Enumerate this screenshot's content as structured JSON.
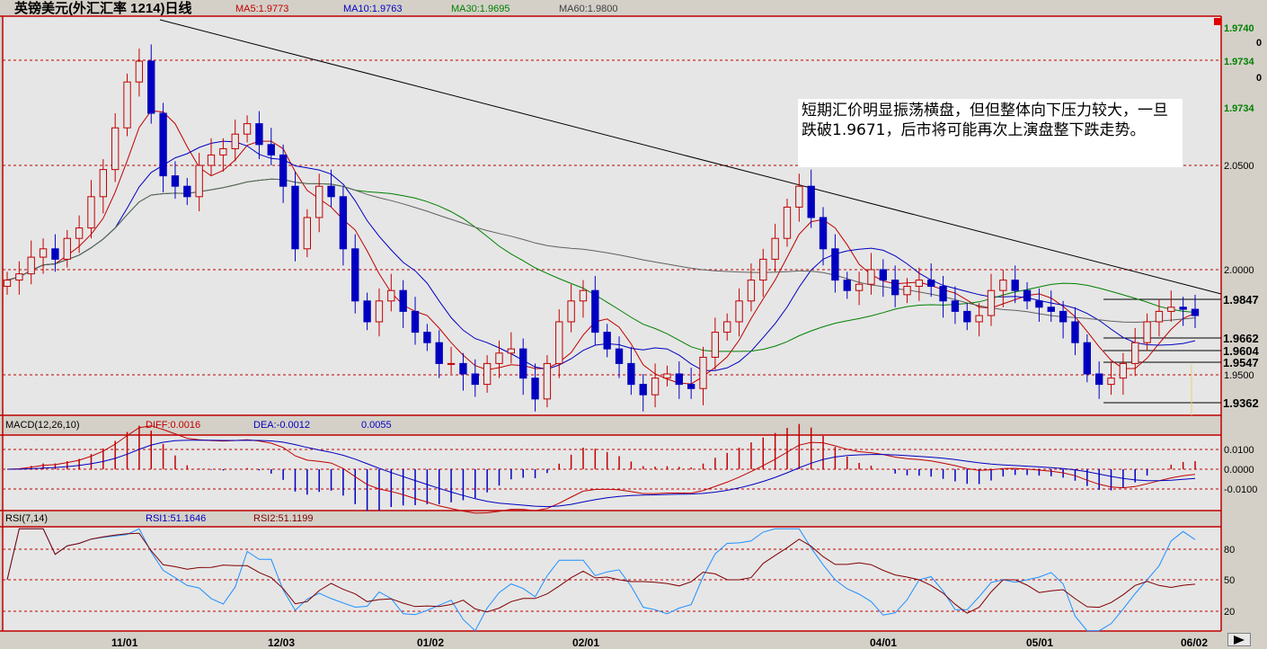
{
  "header": {
    "title": "英镑美元(外汇汇率 1214)日线",
    "ma": [
      {
        "label": "MA5:1.9773",
        "color": "#c00000"
      },
      {
        "label": "MA10:1.9763",
        "color": "#0000c0"
      },
      {
        "label": "MA30:1.9695",
        "color": "#008000"
      },
      {
        "label": "MA60:1.9800",
        "color": "#606060"
      }
    ]
  },
  "annotation": {
    "text": "短期汇价明显振荡横盘，但但整体向下压力较大，一旦跌破1.9671，后市将可能再次上演盘整下跌走势。"
  },
  "right_top_values": [
    "1.9740",
    "0",
    "1.9734",
    "0",
    "1.9734"
  ],
  "price_levels": [
    "1.9847",
    "1.9662",
    "1.9604",
    "1.9547",
    "1.9362"
  ],
  "macd": {
    "title": "MACD(12,26,10)",
    "diff": "DIFF:0.0016",
    "dea": "DEA:-0.0012",
    "macd_value": "0.0055"
  },
  "rsi": {
    "title": "RSI(7,14)",
    "rsi1": "RSI1:51.1646",
    "rsi2": "RSI2:51.1199"
  },
  "x_axis": [
    "11/01",
    "12/03",
    "01/02",
    "02/01",
    "04/01",
    "05/01",
    "06/02"
  ],
  "chart_data": {
    "type": "candlestick",
    "y_axis_ticks": [
      "2.0500",
      "2.0000",
      "1.9500"
    ],
    "macd_ticks": [
      "0.0100",
      "0.0000",
      "-0.0100"
    ],
    "rsi_ticks": [
      "80",
      "50",
      "20"
    ],
    "close_series": [
      1.995,
      1.998,
      2.006,
      2.01,
      2.005,
      2.015,
      2.02,
      2.035,
      2.048,
      2.068,
      2.09,
      2.1,
      2.075,
      2.045,
      2.04,
      2.035,
      2.05,
      2.055,
      2.058,
      2.065,
      2.07,
      2.06,
      2.055,
      2.04,
      2.01,
      2.025,
      2.04,
      2.035,
      2.01,
      1.985,
      1.975,
      1.985,
      1.99,
      1.98,
      1.97,
      1.965,
      1.955,
      1.955,
      1.95,
      1.945,
      1.955,
      1.96,
      1.962,
      1.948,
      1.938,
      1.955,
      1.975,
      1.985,
      1.99,
      1.97,
      1.962,
      1.955,
      1.945,
      1.94,
      1.948,
      1.95,
      1.945,
      1.943,
      1.958,
      1.97,
      1.975,
      1.985,
      1.995,
      2.005,
      2.015,
      2.03,
      2.04,
      2.025,
      2.01,
      1.995,
      1.99,
      1.993,
      2.0,
      1.995,
      1.988,
      1.992,
      1.995,
      1.992,
      1.985,
      1.98,
      1.975,
      1.978,
      1.99,
      1.995,
      1.99,
      1.985,
      1.982,
      1.98,
      1.975,
      1.965,
      1.95,
      1.945,
      1.948,
      1.955,
      1.965,
      1.975,
      1.98,
      1.982,
      1.981,
      1.978
    ],
    "ma_periods": [
      5,
      10,
      30,
      60
    ],
    "ma_colors": [
      "#c00000",
      "#0000c0",
      "#008000",
      "#606060"
    ],
    "rsi1_color": "#1e90ff",
    "rsi2_color": "#800000",
    "up_color": "#c00000",
    "down_color": "#0000c0",
    "trend_line_color": "#000000"
  }
}
